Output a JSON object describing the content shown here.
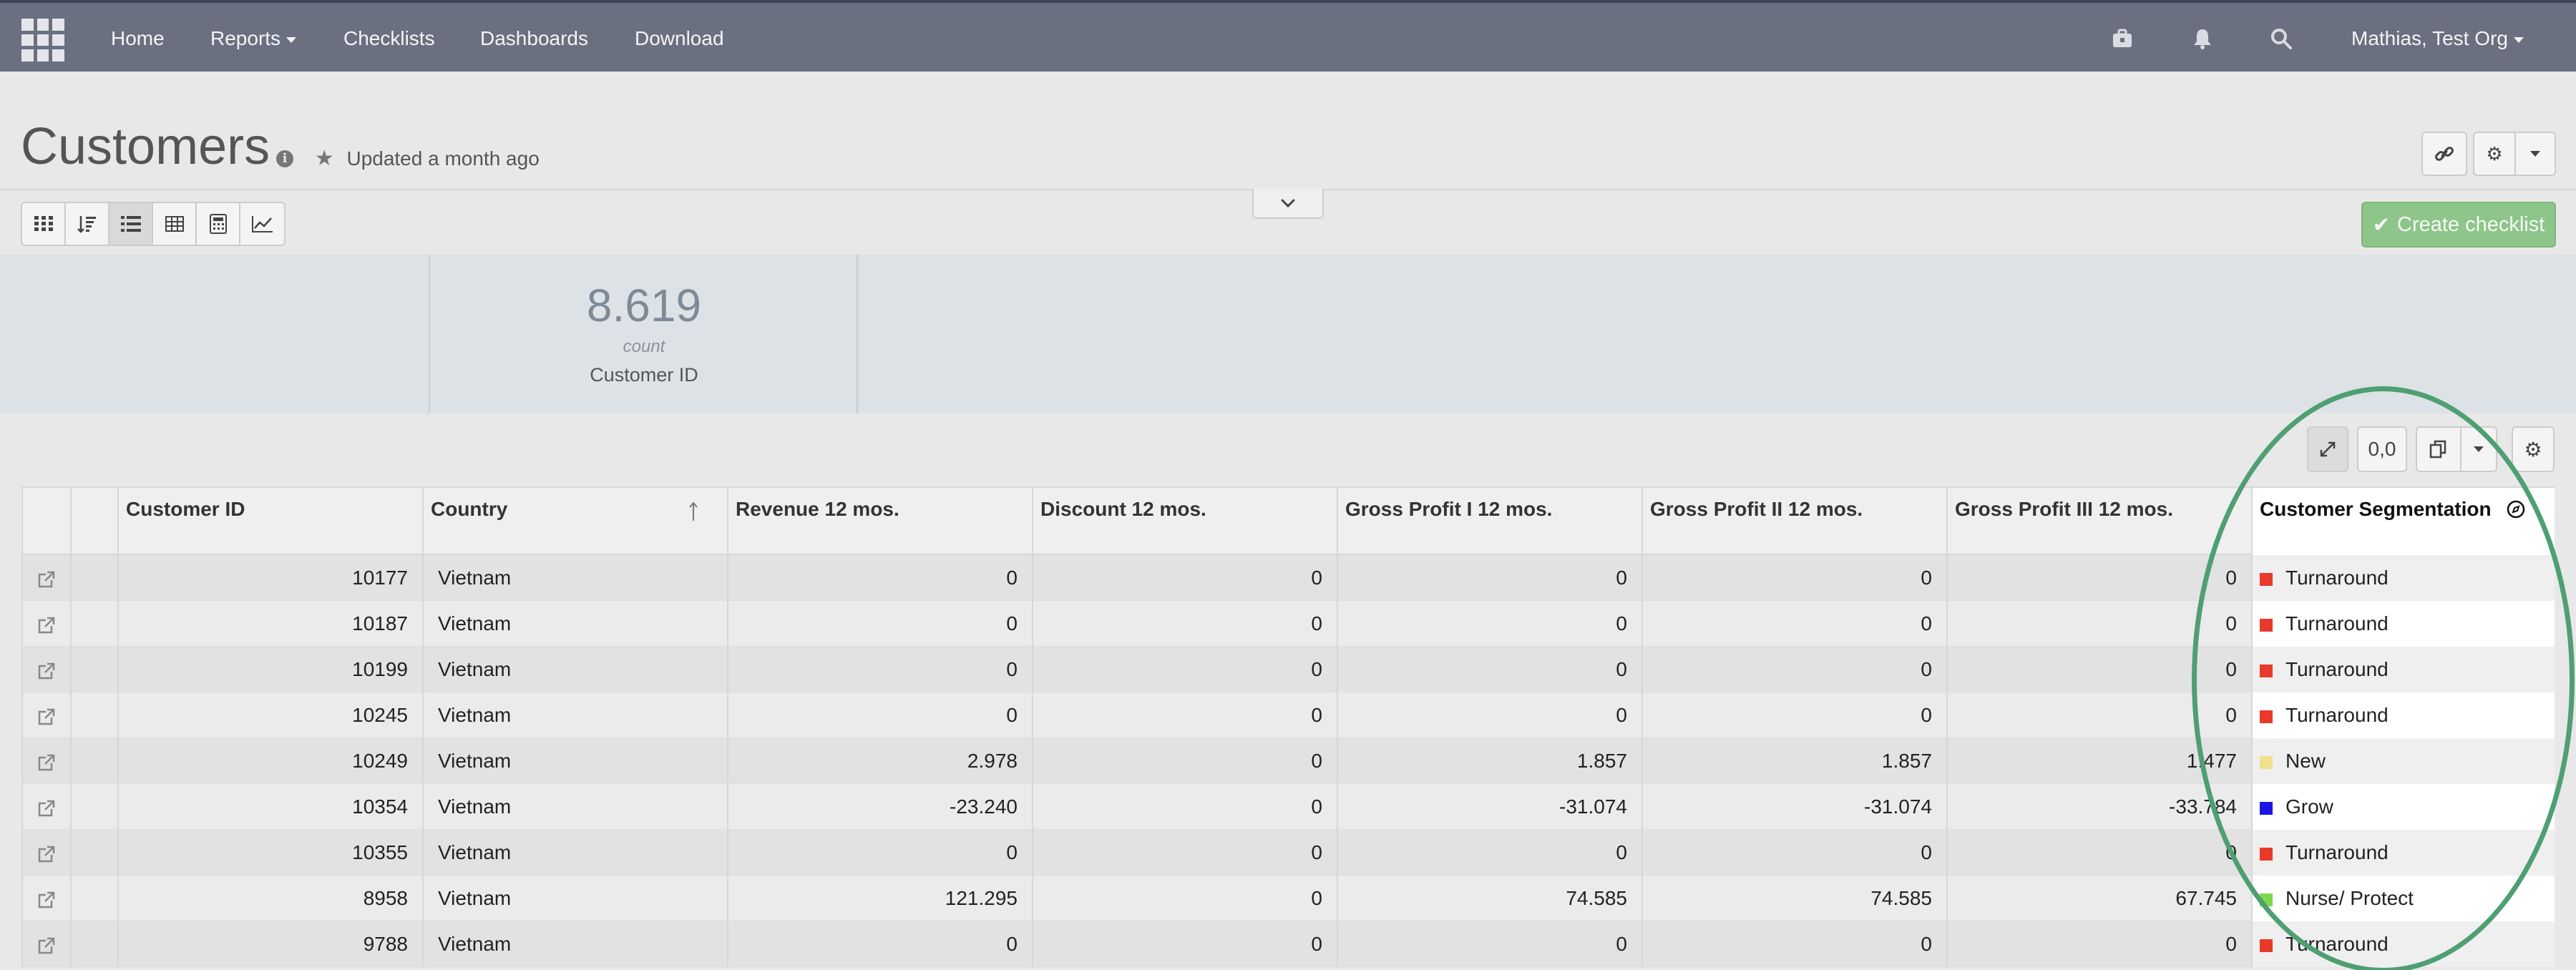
{
  "nav": {
    "items": [
      {
        "label": "Home"
      },
      {
        "label": "Reports"
      },
      {
        "label": "Checklists"
      },
      {
        "label": "Dashboards"
      },
      {
        "label": "Download"
      }
    ],
    "user": "Mathias, Test Org"
  },
  "page": {
    "title": "Customers",
    "updated": "Updated a month ago"
  },
  "actions": {
    "create_checklist": "Create checklist"
  },
  "kpi": {
    "value": "8.619",
    "aggregation": "count",
    "label": "Customer ID"
  },
  "table_toolbar": {
    "format_label": "0,0"
  },
  "table": {
    "columns": [
      "",
      "",
      "Customer ID",
      "Country",
      "Revenue 12 mos.",
      "Discount 12 mos.",
      "Gross Profit I 12 mos.",
      "Gross Profit II 12 mos.",
      "Gross Profit III 12 mos.",
      "Customer Segmentation"
    ],
    "rows": [
      {
        "id": "10177",
        "country": "Vietnam",
        "revenue": "0",
        "discount": "0",
        "gp1": "0",
        "gp2": "0",
        "gp3": "0",
        "segment": "Turnaround",
        "seg_color": "#e8392b"
      },
      {
        "id": "10187",
        "country": "Vietnam",
        "revenue": "0",
        "discount": "0",
        "gp1": "0",
        "gp2": "0",
        "gp3": "0",
        "segment": "Turnaround",
        "seg_color": "#e8392b"
      },
      {
        "id": "10199",
        "country": "Vietnam",
        "revenue": "0",
        "discount": "0",
        "gp1": "0",
        "gp2": "0",
        "gp3": "0",
        "segment": "Turnaround",
        "seg_color": "#e8392b"
      },
      {
        "id": "10245",
        "country": "Vietnam",
        "revenue": "0",
        "discount": "0",
        "gp1": "0",
        "gp2": "0",
        "gp3": "0",
        "segment": "Turnaround",
        "seg_color": "#e8392b"
      },
      {
        "id": "10249",
        "country": "Vietnam",
        "revenue": "2.978",
        "discount": "0",
        "gp1": "1.857",
        "gp2": "1.857",
        "gp3": "1.477",
        "segment": "New",
        "seg_color": "#f0e08a"
      },
      {
        "id": "10354",
        "country": "Vietnam",
        "revenue": "-23.240",
        "discount": "0",
        "gp1": "-31.074",
        "gp2": "-31.074",
        "gp3": "-33.784",
        "segment": "Grow",
        "seg_color": "#1a17e6"
      },
      {
        "id": "10355",
        "country": "Vietnam",
        "revenue": "0",
        "discount": "0",
        "gp1": "0",
        "gp2": "0",
        "gp3": "0",
        "segment": "Turnaround",
        "seg_color": "#e8392b"
      },
      {
        "id": "8958",
        "country": "Vietnam",
        "revenue": "121.295",
        "discount": "0",
        "gp1": "74.585",
        "gp2": "74.585",
        "gp3": "67.745",
        "segment": "Nurse/ Protect",
        "seg_color": "#7bd94d"
      },
      {
        "id": "9788",
        "country": "Vietnam",
        "revenue": "0",
        "discount": "0",
        "gp1": "0",
        "gp2": "0",
        "gp3": "0",
        "segment": "Turnaround",
        "seg_color": "#e8392b"
      }
    ]
  },
  "icons": {
    "apps": "grid-icon",
    "briefcase": "briefcase-icon",
    "bell": "bell-icon",
    "search": "search-icon",
    "info": "info-icon",
    "star": "star-icon",
    "link": "link-icon",
    "gear": "gear-icon",
    "chevron": "chevron-down-icon",
    "expand": "expand-icon",
    "copy": "copy-icon",
    "external": "external-link-icon",
    "sort": "sort-ascending-icon",
    "segmentation": "compass-icon"
  }
}
